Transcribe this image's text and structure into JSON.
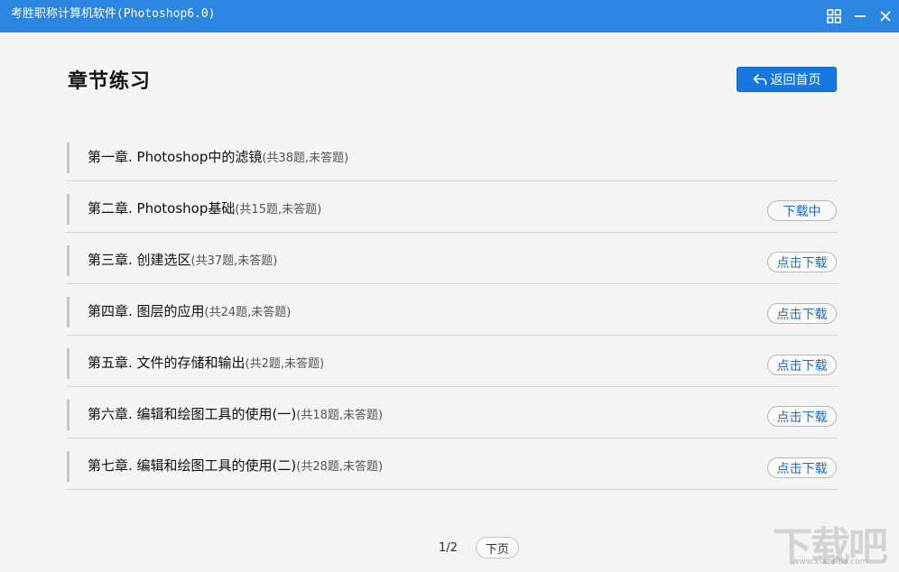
{
  "window": {
    "title": "考胜职称计算机软件(Photoshop6.0)",
    "controls": [
      "grid-icon",
      "minimize-icon",
      "close-icon"
    ]
  },
  "header": {
    "title": "章节练习",
    "home_button": "返回首页"
  },
  "chapters": [
    {
      "title": "第一章. Photoshop中的滤镜",
      "count": "(共38题,未答题)",
      "action": ""
    },
    {
      "title": "第二章. Photoshop基础",
      "count": "(共15题,未答题)",
      "action": "下载中"
    },
    {
      "title": "第三章. 创建选区",
      "count": "(共37题,未答题)",
      "action": "点击下载"
    },
    {
      "title": "第四章. 图层的应用",
      "count": "(共24题,未答题)",
      "action": "点击下载"
    },
    {
      "title": "第五章. 文件的存储和输出",
      "count": "(共2题,未答题)",
      "action": "点击下载"
    },
    {
      "title": "第六章. 编辑和绘图工具的使用(一)",
      "count": "(共18题,未答题)",
      "action": "点击下载"
    },
    {
      "title": "第七章. 编辑和绘图工具的使用(二)",
      "count": "(共28题,未答题)",
      "action": "点击下载"
    }
  ],
  "pager": {
    "page_info": "1/2",
    "next_label": "下页"
  },
  "watermark": {
    "text": "下载吧",
    "url": "www.xiazaiba.com"
  },
  "colors": {
    "titlebar": "#2a86e0",
    "primary_button": "#1677e0",
    "link_text": "#1a6fc7"
  }
}
